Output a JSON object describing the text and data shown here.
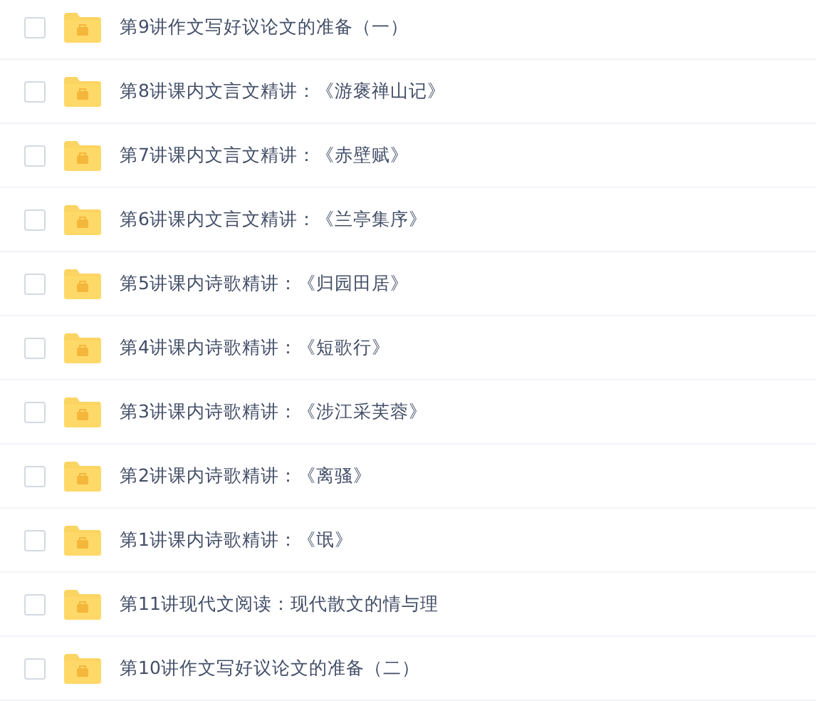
{
  "files": [
    {
      "name": "第9讲作文写好议论文的准备（一）",
      "checked": false
    },
    {
      "name": "第8讲课内文言文精讲：《游褒禅山记》",
      "checked": false
    },
    {
      "name": "第7讲课内文言文精讲：《赤壁赋》",
      "checked": false
    },
    {
      "name": "第6讲课内文言文精讲：《兰亭集序》",
      "checked": false
    },
    {
      "name": "第5讲课内诗歌精讲：《归园田居》",
      "checked": false
    },
    {
      "name": "第4讲课内诗歌精讲：《短歌行》",
      "checked": false
    },
    {
      "name": "第3讲课内诗歌精讲：《涉江采芙蓉》",
      "checked": false
    },
    {
      "name": "第2讲课内诗歌精讲：《离骚》",
      "checked": false
    },
    {
      "name": "第1讲课内诗歌精讲：《氓》",
      "checked": false
    },
    {
      "name": "第11讲现代文阅读：现代散文的情与理",
      "checked": false
    },
    {
      "name": "第10讲作文写好议论文的准备（二）",
      "checked": false
    }
  ]
}
